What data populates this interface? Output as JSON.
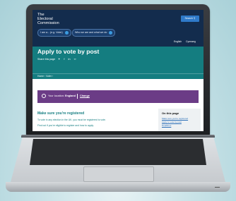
{
  "site": {
    "logo_lines": [
      "The",
      "Electoral",
      "Commission"
    ],
    "help_button": "I am a... (e.g. Voter)",
    "about_button": "Who we are and what we do",
    "search_label": "Search",
    "languages": {
      "english": "English",
      "welsh": "Cymraeg"
    }
  },
  "page": {
    "title": "Apply to vote by post",
    "share_label": "Share this page",
    "share_icons": [
      "twitter-icon",
      "facebook-icon",
      "linkedin-icon",
      "link-icon"
    ],
    "breadcrumbs": "Home  ›  Voter  ›"
  },
  "location": {
    "label": "Your location:",
    "value": "England",
    "change_label": "Change"
  },
  "content": {
    "heading": "Make sure you're registered",
    "line1": "To vote in any election in the UK, you must be registered to vote.",
    "line2": "Find out if you're eligible to register and how to apply."
  },
  "sidebar": {
    "title": "On this page",
    "links": [
      "Make sure you're registered",
      "Apply to vote by post",
      "Deadlines"
    ]
  },
  "colors": {
    "header": "#132c4d",
    "banner": "#147d80",
    "location_panel": "#6b3c86"
  }
}
